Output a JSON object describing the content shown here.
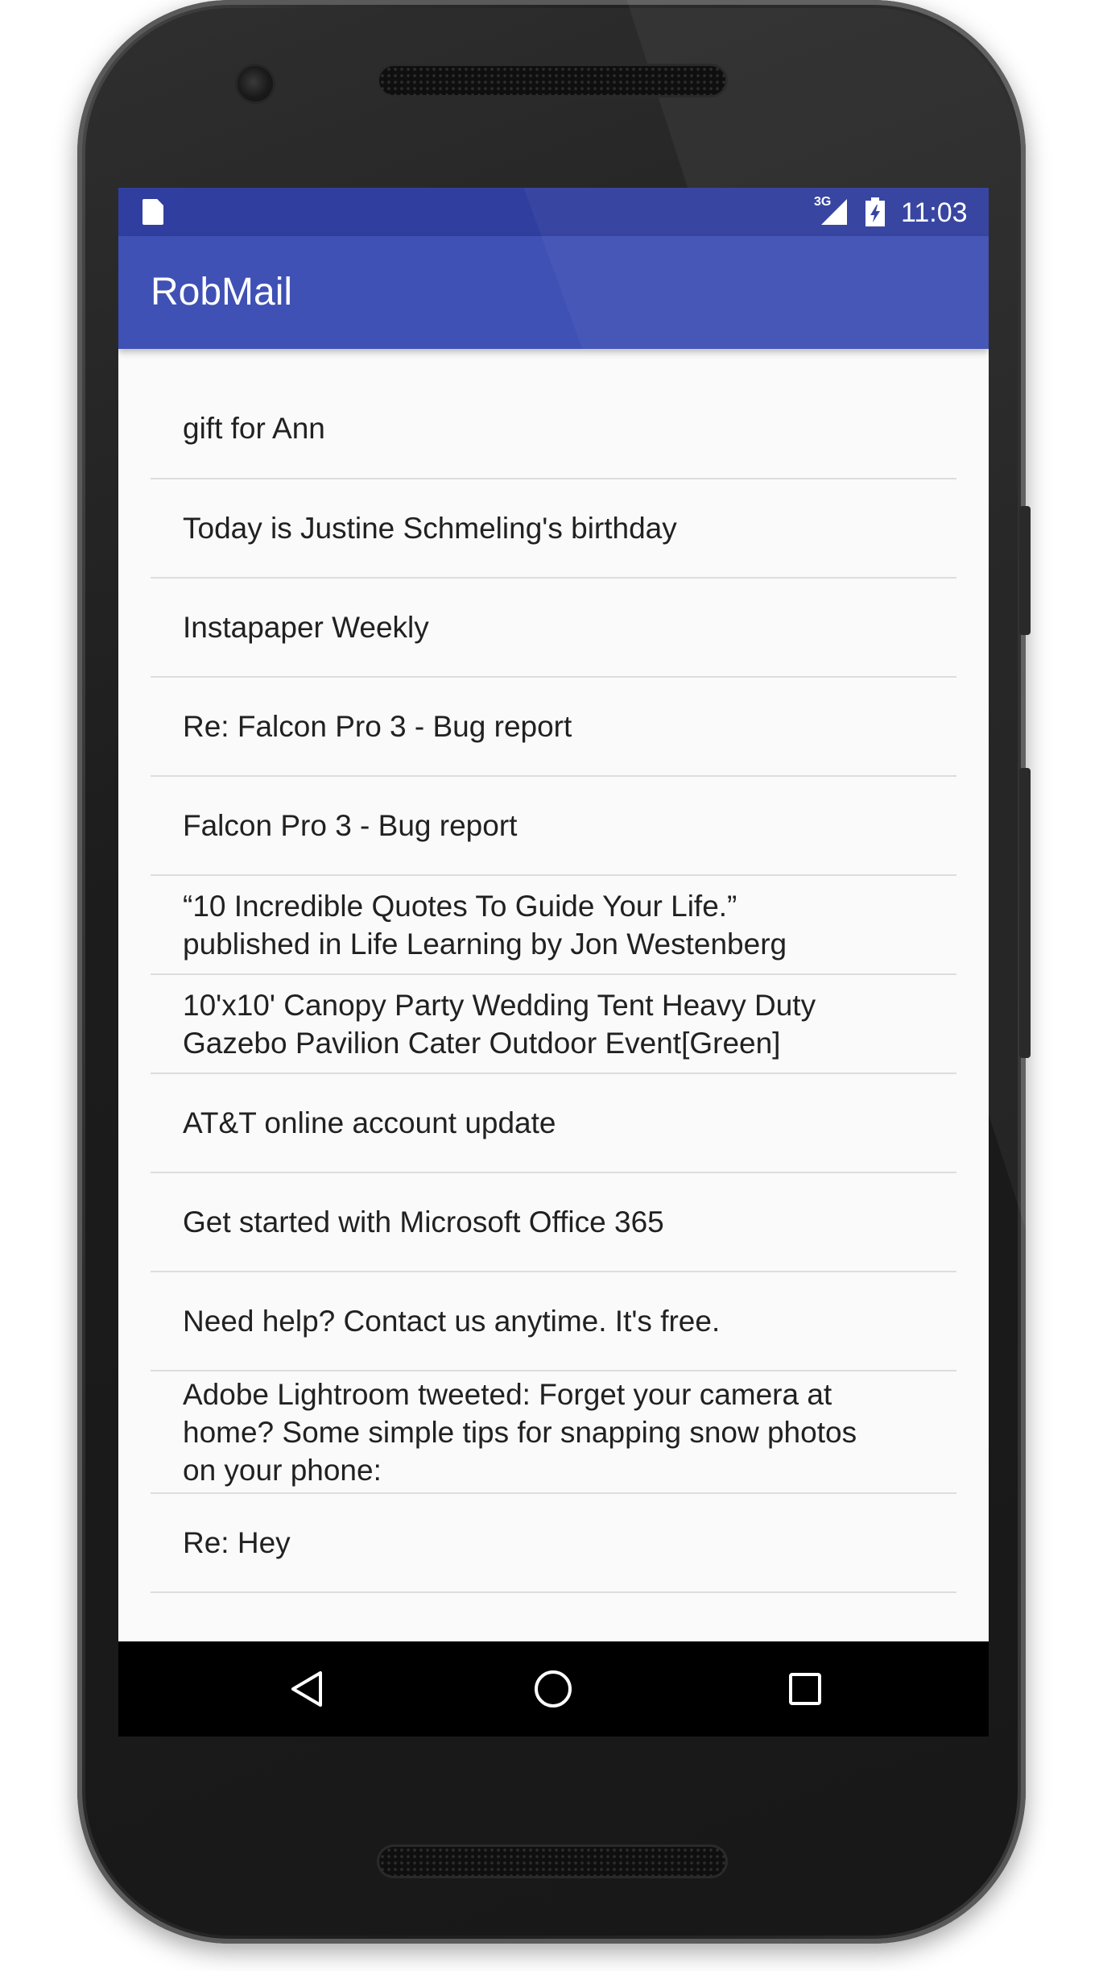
{
  "status_bar": {
    "network_label": "3G",
    "time": "11:03",
    "icons": [
      "sd-card-icon",
      "signal-icon",
      "battery-charging-icon"
    ]
  },
  "app_bar": {
    "title": "RobMail",
    "color": "#3f51b5",
    "status_color": "#303f9f"
  },
  "messages": [
    {
      "subject": "gift for Ann"
    },
    {
      "subject": "Today is Justine Schmeling's birthday"
    },
    {
      "subject": "Instapaper Weekly"
    },
    {
      "subject": "Re: Falcon Pro 3 - Bug report"
    },
    {
      "subject": "Falcon Pro 3 - Bug report"
    },
    {
      "subject": "“10 Incredible Quotes To Guide Your Life.”\npublished in Life Learning by Jon Westenberg"
    },
    {
      "subject": "10'x10' Canopy Party Wedding Tent Heavy Duty\nGazebo Pavilion Cater Outdoor Event[Green]"
    },
    {
      "subject": "AT&T online account update"
    },
    {
      "subject": "Get started with Microsoft Office 365"
    },
    {
      "subject": "Need help? Contact us anytime. It's free."
    },
    {
      "subject": "Adobe Lightroom tweeted: Forget your camera at\nhome? Some simple tips for snapping snow photos\non your phone:"
    },
    {
      "subject": "Re: Hey"
    }
  ],
  "nav_bar": {
    "buttons": [
      "back-icon",
      "home-icon",
      "recent-apps-icon"
    ]
  }
}
